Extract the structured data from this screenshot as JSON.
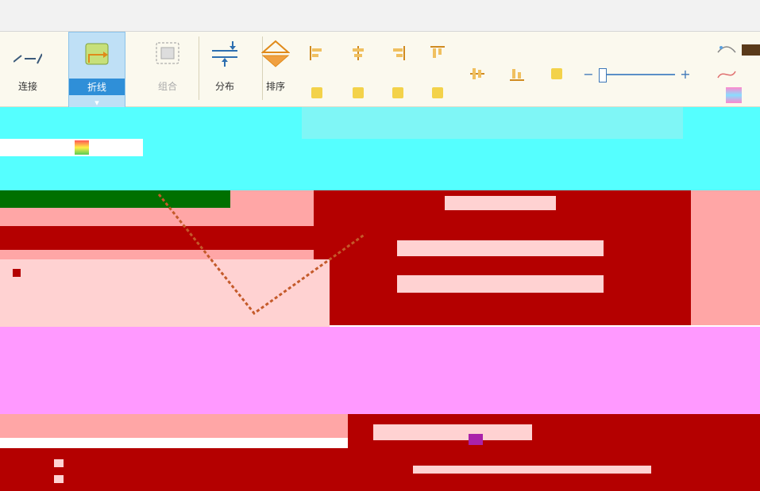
{
  "ribbon": {
    "tools": [
      {
        "name": "connector",
        "label": "连接"
      },
      {
        "name": "polyline",
        "label": "折线"
      },
      {
        "name": "group",
        "label": "组合"
      },
      {
        "name": "distribute",
        "label": "分布"
      },
      {
        "name": "arrange",
        "label": "排序"
      }
    ]
  },
  "zoom": {
    "minus": "−",
    "plus": "+"
  },
  "colors": {
    "ribbon_bg": "#fbf9ee",
    "active_blue": "#2f8fd8",
    "cyan": "#55ffff",
    "red": "#b40000",
    "pink": "#ffa6a6",
    "magenta": "#ff99ff",
    "green": "#007000"
  }
}
